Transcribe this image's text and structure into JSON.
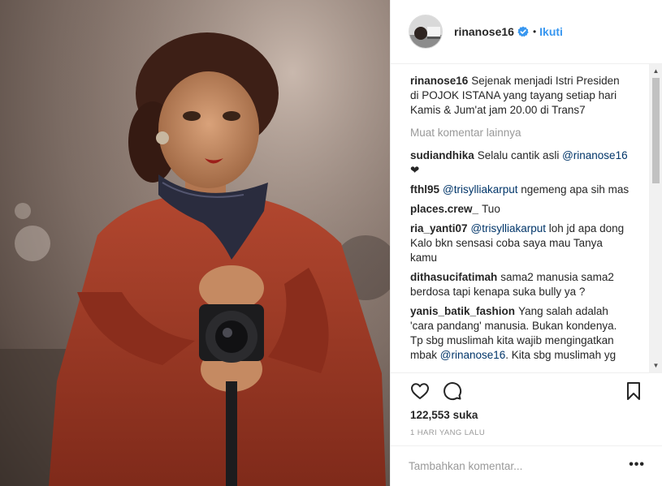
{
  "header": {
    "username": "rinanose16",
    "separator": "•",
    "follow_label": "Ikuti"
  },
  "caption": {
    "username": "rinanose16",
    "text": "Sejenak menjadi Istri Presiden di POJOK ISTANA yang tayang setiap hari Kamis & Jum'at jam 20.00 di Trans7"
  },
  "more_comments_label": "Muat komentar lainnya",
  "comments": [
    {
      "user": "sudiandhika",
      "pre": "Selalu cantik asli ",
      "mention": "@rinanose16",
      "post": " ❤"
    },
    {
      "user": "fthl95",
      "pre": "",
      "mention": "@trisylliakarput",
      "post": " ngemeng apa sih mas"
    },
    {
      "user": "places.crew_",
      "pre": "Tuo",
      "mention": "",
      "post": ""
    },
    {
      "user": "ria_yanti07",
      "pre": "",
      "mention": "@trisylliakarput",
      "post": " loh jd apa dong Kalo bkn sensasi coba saya mau Tanya kamu"
    },
    {
      "user": "dithasucifatimah",
      "pre": "sama2 manusia sama2 berdosa tapi kenapa suka bully ya ?",
      "mention": "",
      "post": ""
    },
    {
      "user": "yanis_batik_fashion",
      "pre": "Yang salah adalah 'cara pandang' manusia. Bukan kondenya. Tp sbg muslimah kita wajib mengingatkan mbak ",
      "mention": "@rinanose16",
      "post": ". Kita sbg muslimah yg"
    }
  ],
  "likes": {
    "count": "122,553",
    "label": "suka"
  },
  "timestamp": "1 HARI YANG LALU",
  "add_comment": {
    "placeholder": "Tambahkan komentar..."
  },
  "options_label": "•••",
  "icons": {
    "like": "heart-icon",
    "comment": "comment-icon",
    "save": "bookmark-icon",
    "verified": "verified-badge-icon"
  },
  "colors": {
    "link_blue": "#3897f0",
    "mention_blue": "#003569",
    "muted_gray": "#999999",
    "text": "#262626"
  }
}
